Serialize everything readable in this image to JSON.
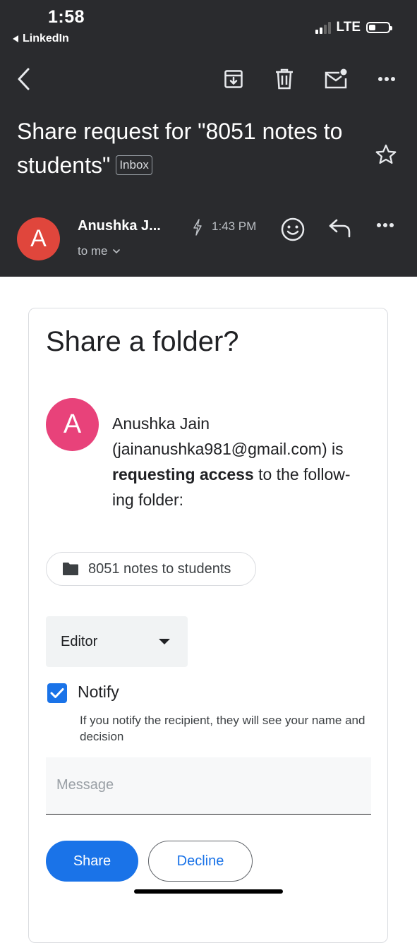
{
  "status_bar": {
    "time": "1:58",
    "back_app": "LinkedIn",
    "network": "LTE"
  },
  "toolbar": {
    "icons": [
      "back-arrow-icon",
      "archive-icon",
      "trash-icon",
      "mark-unread-icon",
      "more-icon"
    ]
  },
  "email": {
    "subject": "Share request for \"8051 notes to students\"",
    "label": "Inbox",
    "sender_initial": "A",
    "sender": "Anushka J...",
    "time": "1:43 PM",
    "recipient": "to me"
  },
  "share_card": {
    "title": "Share a folder?",
    "avatar_initial": "A",
    "requester_name": "Anushka Jain",
    "requester_email": "(jainanushka981@gmail.com) is",
    "request_bold": "requesting access",
    "request_rest_1": " to the follow-",
    "request_rest_2": "ing folder:",
    "folder_name": "8051 notes to students",
    "role": "Editor",
    "notify_label": "Notify",
    "notify_checked": true,
    "notify_help": "If you notify the recipient, they will see your name and decision",
    "message_placeholder": "Message",
    "share_label": "Share",
    "decline_label": "Decline"
  },
  "colors": {
    "header_bg": "#2a2b2e",
    "accent": "#1a73e8",
    "sender_avatar": "#e0463c",
    "requester_avatar": "#e8427a"
  }
}
